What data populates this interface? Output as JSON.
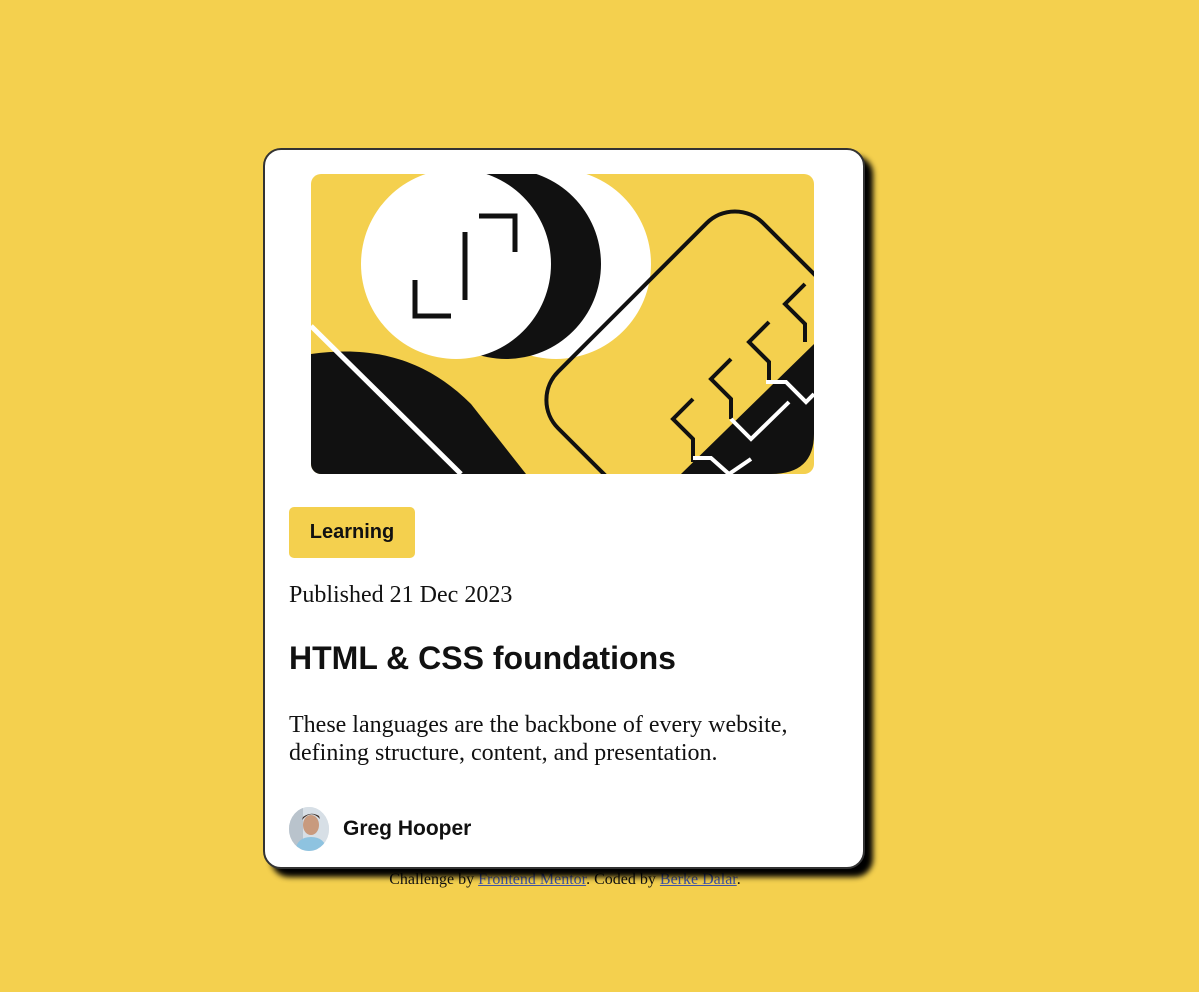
{
  "card": {
    "image_alt": "illustration-article",
    "tag": "Learning",
    "published": "Published 21 Dec 2023",
    "title": "HTML & CSS foundations",
    "description": "These languages are the backbone of every website, defining structure, content, and presentation.",
    "author": {
      "name": "Greg Hooper",
      "avatar_icon": "avatar-photo"
    }
  },
  "attribution": {
    "prefix": "Challenge by ",
    "link1": "Frontend Mentor",
    "middle": ". Coded by ",
    "link2": "Berke Dalar",
    "suffix": "."
  },
  "colors": {
    "background": "#f4d04e",
    "card": "#ffffff",
    "text": "#111111",
    "link": "#3e52a3"
  }
}
